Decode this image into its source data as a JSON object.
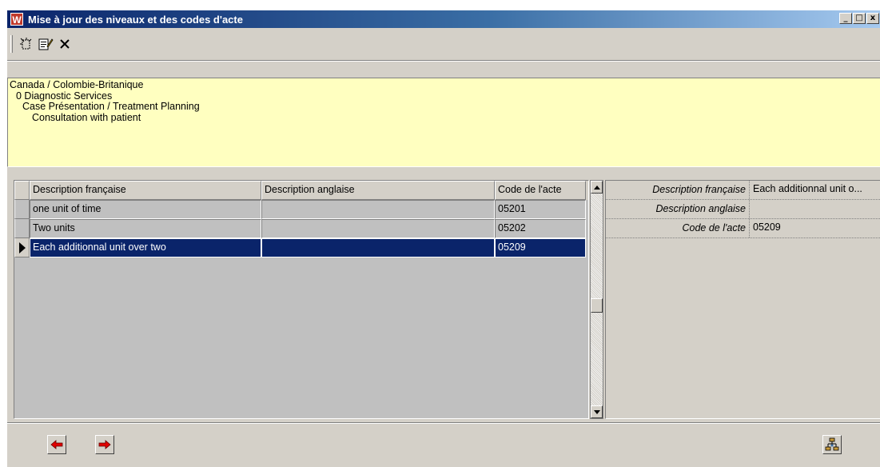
{
  "window": {
    "title": "Mise à jour des niveaux et des codes d'acte",
    "app_icon_letter": "W",
    "controls": {
      "minimize": "_",
      "maximize": "□",
      "close": "x"
    }
  },
  "toolbar": {
    "items": [
      {
        "name": "new-icon",
        "glyph": "⎘"
      },
      {
        "name": "edit-icon",
        "glyph": "✎"
      },
      {
        "name": "delete-icon",
        "glyph": "✕"
      }
    ]
  },
  "path": {
    "lines": [
      "Canada / Colombie-Britanique",
      "0 Diagnostic Services",
      "Case Présentation / Treatment Planning",
      "Consultation with patient"
    ]
  },
  "grid": {
    "columns": [
      "Description française",
      "Description anglaise",
      "Code de l'acte"
    ],
    "rows": [
      {
        "fr": "one unit of time",
        "en": "",
        "code": "05201"
      },
      {
        "fr": "Two units",
        "en": "",
        "code": "05202"
      },
      {
        "fr": "Each additionnal unit over two",
        "en": "",
        "code": "05209"
      }
    ],
    "selected_row": 2
  },
  "properties": {
    "rows": [
      {
        "label": "Description française",
        "value": "Each additionnal unit o..."
      },
      {
        "label": "Description anglaise",
        "value": ""
      },
      {
        "label": "Code de l'acte",
        "value": "05209"
      }
    ]
  },
  "colors": {
    "window_bg": "#d4d0c8",
    "path_bg": "#ffffc0",
    "selection_bg": "#0a246a",
    "title_gradient_start": "#0a246a",
    "nav_arrow": "#e00000"
  }
}
